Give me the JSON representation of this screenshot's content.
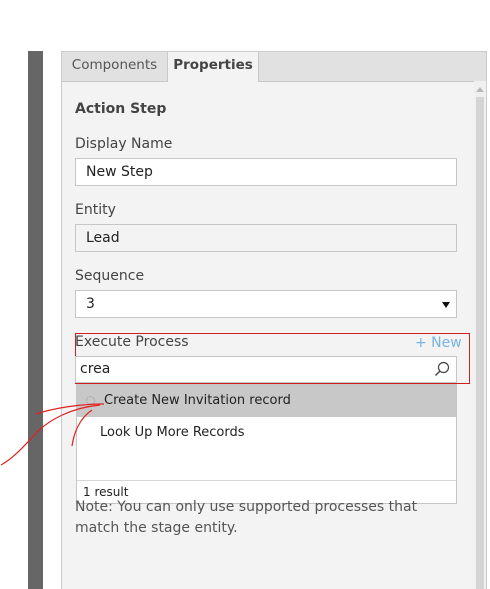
{
  "tabs": [
    {
      "label": "Components",
      "active": false
    },
    {
      "label": "Properties",
      "active": true
    }
  ],
  "section": {
    "heading": "Action Step"
  },
  "display_name": {
    "label": "Display Name",
    "value": "New Step"
  },
  "entity": {
    "label": "Entity",
    "value": "Lead"
  },
  "sequence": {
    "label": "Sequence",
    "value": "3"
  },
  "execute_process": {
    "label": "Execute Process",
    "new_link": "+ New",
    "search_value": "crea",
    "results": [
      "Create New Invitation record"
    ],
    "lookup_more": "Look Up More Records",
    "result_count": "1 result"
  },
  "note": {
    "text": "Note: You can only use supported processes that match the stage entity."
  },
  "icons": {
    "search": "search-icon",
    "dropdown": "chevron-down-icon",
    "loading": "spinner-icon"
  },
  "colors": {
    "highlight": "#cc2020",
    "link": "#7ab3e0",
    "selected_row": "#c8c8c8"
  }
}
